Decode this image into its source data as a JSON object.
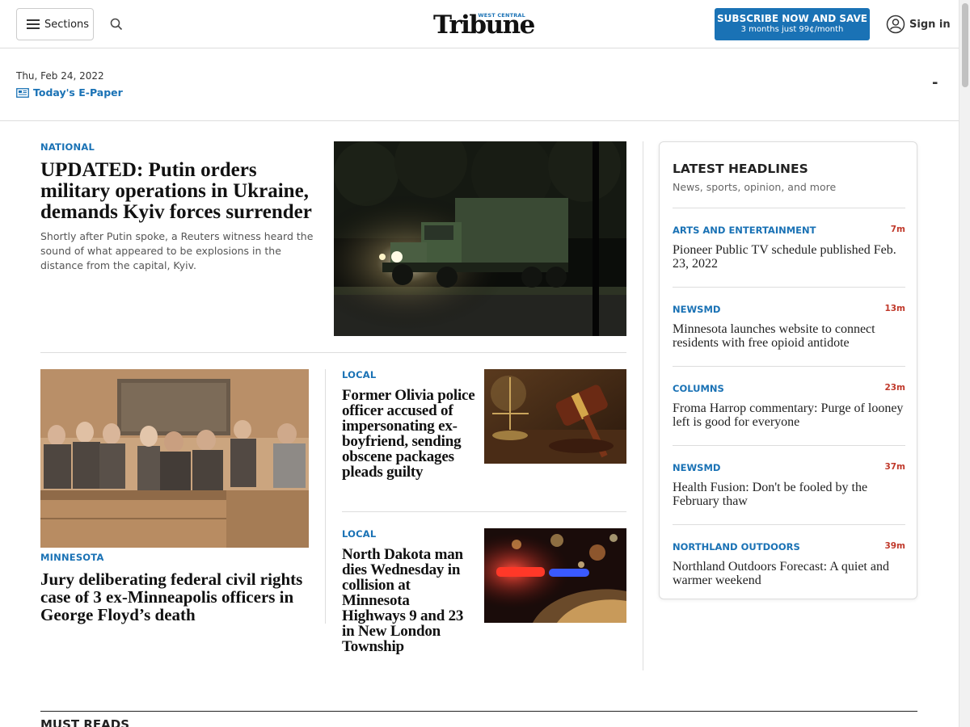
{
  "header": {
    "sections_label": "Sections",
    "logo_small": "WEST CENTRAL",
    "logo_main": "Tribune",
    "subscribe_line1": "SUBSCRIBE NOW AND SAVE",
    "subscribe_line2": "3 months just 99¢/month",
    "signin_label": "Sign in",
    "brand_color": "#1a72b5"
  },
  "datebar": {
    "date": "Thu, Feb 24, 2022",
    "epaper_label": "Today's E-Paper",
    "weather": "-"
  },
  "lead_story": {
    "kicker": "NATIONAL",
    "title": "UPDATED: Putin orders military operations in Ukraine, demands Kyiv forces surrender",
    "summary": "Shortly after Putin spoke, a Reuters witness heard the sound of what appeared to be explosions in the distance from the capital, Kyiv."
  },
  "court_story": {
    "kicker": "MINNESOTA",
    "title": "Jury deliberating federal civil rights case of 3 ex-Minneapolis officers in George Floyd’s death"
  },
  "small_stories": [
    {
      "kicker": "LOCAL",
      "title": "Former Olivia police officer accused of impersonating ex-boyfriend, sending obscene packages pleads guilty"
    },
    {
      "kicker": "LOCAL",
      "title": "North Dakota man dies Wednesday in collision at Minnesota Highways 9 and 23 in New London Township"
    }
  ],
  "sidebar": {
    "title": "LATEST HEADLINES",
    "subtitle": "News, sports, opinion, and more",
    "items": [
      {
        "category": "ARTS AND ENTERTAINMENT",
        "time": "7m",
        "headline": "Pioneer Public TV schedule published Feb. 23, 2022"
      },
      {
        "category": "NEWSMD",
        "time": "13m",
        "headline": "Minnesota launches website to connect residents with free opioid antidote"
      },
      {
        "category": "COLUMNS",
        "time": "23m",
        "headline": "Froma Harrop commentary: Purge of looney left is good for everyone"
      },
      {
        "category": "NEWSMD",
        "time": "37m",
        "headline": "Health Fusion: Don't be fooled by the February thaw"
      },
      {
        "category": "NORTHLAND OUTDOORS",
        "time": "39m",
        "headline": "Northland Outdoors Forecast: A quiet and warmer weekend"
      }
    ]
  },
  "must_reads": {
    "title": "MUST READS"
  }
}
